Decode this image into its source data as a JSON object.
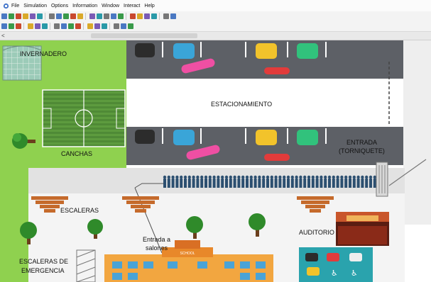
{
  "menu": {
    "items": [
      "File",
      "Simulation",
      "Options",
      "Information",
      "Window",
      "Interact",
      "Help"
    ]
  },
  "toolbar": {
    "row1_icons": [
      "new-icon",
      "open-icon",
      "save-icon",
      "print-icon",
      "cut-icon",
      "copy-icon",
      "paste-icon",
      "undo-icon",
      "redo-icon",
      "zoom-icon",
      "run-icon",
      "step-icon",
      "stop-icon",
      "reset-icon",
      "trace-icon",
      "graph-icon",
      "settings-icon",
      "model-icon",
      "layout-icon",
      "animate-icon",
      "track-icon",
      "help-icon"
    ],
    "row2_icons": [
      "align-left-icon",
      "align-center-icon",
      "align-right-icon",
      "grid-icon",
      "snap-icon",
      "layer-icon",
      "group-icon",
      "ungroup-icon",
      "front-icon",
      "back-icon",
      "rotate-icon",
      "flip-icon",
      "color-icon",
      "text-icon",
      "shape-icon",
      "line-icon"
    ]
  },
  "scrollbar": {
    "left_arrow": "<"
  },
  "labels": {
    "invernadero": "INVERNADERO",
    "estacionamiento": "ESTACIONAMIENTO",
    "canchas": "CANCHAS",
    "entrada_line1": "ENTRADA",
    "entrada_line2": "(TORNIQUETE)",
    "escaleras": "ESCALERAS",
    "entrada_salones_line1": "Entrada a",
    "entrada_salones_line2": "salones",
    "auditorio": "AUDITORIO",
    "escaleras_emergencia_line1": "ESCALERAS DE",
    "escaleras_emergencia_line2": "EMERGENCIA",
    "school_sign": "SCHOOL"
  },
  "colors": {
    "grass": "#8fd14f",
    "parking": "#5d6066",
    "walkway": "#e6e6e6",
    "floor": "#f5f5f5",
    "queue": "#2c4f70"
  }
}
